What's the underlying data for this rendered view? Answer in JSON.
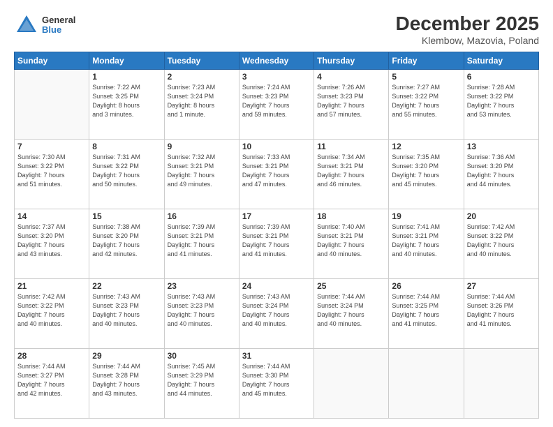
{
  "header": {
    "logo_general": "General",
    "logo_blue": "Blue",
    "title": "December 2025",
    "subtitle": "Klembow, Mazovia, Poland"
  },
  "calendar": {
    "days_of_week": [
      "Sunday",
      "Monday",
      "Tuesday",
      "Wednesday",
      "Thursday",
      "Friday",
      "Saturday"
    ],
    "weeks": [
      [
        {
          "day": "",
          "info": ""
        },
        {
          "day": "1",
          "info": "Sunrise: 7:22 AM\nSunset: 3:25 PM\nDaylight: 8 hours\nand 3 minutes."
        },
        {
          "day": "2",
          "info": "Sunrise: 7:23 AM\nSunset: 3:24 PM\nDaylight: 8 hours\nand 1 minute."
        },
        {
          "day": "3",
          "info": "Sunrise: 7:24 AM\nSunset: 3:23 PM\nDaylight: 7 hours\nand 59 minutes."
        },
        {
          "day": "4",
          "info": "Sunrise: 7:26 AM\nSunset: 3:23 PM\nDaylight: 7 hours\nand 57 minutes."
        },
        {
          "day": "5",
          "info": "Sunrise: 7:27 AM\nSunset: 3:22 PM\nDaylight: 7 hours\nand 55 minutes."
        },
        {
          "day": "6",
          "info": "Sunrise: 7:28 AM\nSunset: 3:22 PM\nDaylight: 7 hours\nand 53 minutes."
        }
      ],
      [
        {
          "day": "7",
          "info": "Sunrise: 7:30 AM\nSunset: 3:22 PM\nDaylight: 7 hours\nand 51 minutes."
        },
        {
          "day": "8",
          "info": "Sunrise: 7:31 AM\nSunset: 3:22 PM\nDaylight: 7 hours\nand 50 minutes."
        },
        {
          "day": "9",
          "info": "Sunrise: 7:32 AM\nSunset: 3:21 PM\nDaylight: 7 hours\nand 49 minutes."
        },
        {
          "day": "10",
          "info": "Sunrise: 7:33 AM\nSunset: 3:21 PM\nDaylight: 7 hours\nand 47 minutes."
        },
        {
          "day": "11",
          "info": "Sunrise: 7:34 AM\nSunset: 3:21 PM\nDaylight: 7 hours\nand 46 minutes."
        },
        {
          "day": "12",
          "info": "Sunrise: 7:35 AM\nSunset: 3:20 PM\nDaylight: 7 hours\nand 45 minutes."
        },
        {
          "day": "13",
          "info": "Sunrise: 7:36 AM\nSunset: 3:20 PM\nDaylight: 7 hours\nand 44 minutes."
        }
      ],
      [
        {
          "day": "14",
          "info": "Sunrise: 7:37 AM\nSunset: 3:20 PM\nDaylight: 7 hours\nand 43 minutes."
        },
        {
          "day": "15",
          "info": "Sunrise: 7:38 AM\nSunset: 3:20 PM\nDaylight: 7 hours\nand 42 minutes."
        },
        {
          "day": "16",
          "info": "Sunrise: 7:39 AM\nSunset: 3:21 PM\nDaylight: 7 hours\nand 41 minutes."
        },
        {
          "day": "17",
          "info": "Sunrise: 7:39 AM\nSunset: 3:21 PM\nDaylight: 7 hours\nand 41 minutes."
        },
        {
          "day": "18",
          "info": "Sunrise: 7:40 AM\nSunset: 3:21 PM\nDaylight: 7 hours\nand 40 minutes."
        },
        {
          "day": "19",
          "info": "Sunrise: 7:41 AM\nSunset: 3:21 PM\nDaylight: 7 hours\nand 40 minutes."
        },
        {
          "day": "20",
          "info": "Sunrise: 7:42 AM\nSunset: 3:22 PM\nDaylight: 7 hours\nand 40 minutes."
        }
      ],
      [
        {
          "day": "21",
          "info": "Sunrise: 7:42 AM\nSunset: 3:22 PM\nDaylight: 7 hours\nand 40 minutes."
        },
        {
          "day": "22",
          "info": "Sunrise: 7:43 AM\nSunset: 3:23 PM\nDaylight: 7 hours\nand 40 minutes."
        },
        {
          "day": "23",
          "info": "Sunrise: 7:43 AM\nSunset: 3:23 PM\nDaylight: 7 hours\nand 40 minutes."
        },
        {
          "day": "24",
          "info": "Sunrise: 7:43 AM\nSunset: 3:24 PM\nDaylight: 7 hours\nand 40 minutes."
        },
        {
          "day": "25",
          "info": "Sunrise: 7:44 AM\nSunset: 3:24 PM\nDaylight: 7 hours\nand 40 minutes."
        },
        {
          "day": "26",
          "info": "Sunrise: 7:44 AM\nSunset: 3:25 PM\nDaylight: 7 hours\nand 41 minutes."
        },
        {
          "day": "27",
          "info": "Sunrise: 7:44 AM\nSunset: 3:26 PM\nDaylight: 7 hours\nand 41 minutes."
        }
      ],
      [
        {
          "day": "28",
          "info": "Sunrise: 7:44 AM\nSunset: 3:27 PM\nDaylight: 7 hours\nand 42 minutes."
        },
        {
          "day": "29",
          "info": "Sunrise: 7:44 AM\nSunset: 3:28 PM\nDaylight: 7 hours\nand 43 minutes."
        },
        {
          "day": "30",
          "info": "Sunrise: 7:45 AM\nSunset: 3:29 PM\nDaylight: 7 hours\nand 44 minutes."
        },
        {
          "day": "31",
          "info": "Sunrise: 7:44 AM\nSunset: 3:30 PM\nDaylight: 7 hours\nand 45 minutes."
        },
        {
          "day": "",
          "info": ""
        },
        {
          "day": "",
          "info": ""
        },
        {
          "day": "",
          "info": ""
        }
      ]
    ]
  }
}
